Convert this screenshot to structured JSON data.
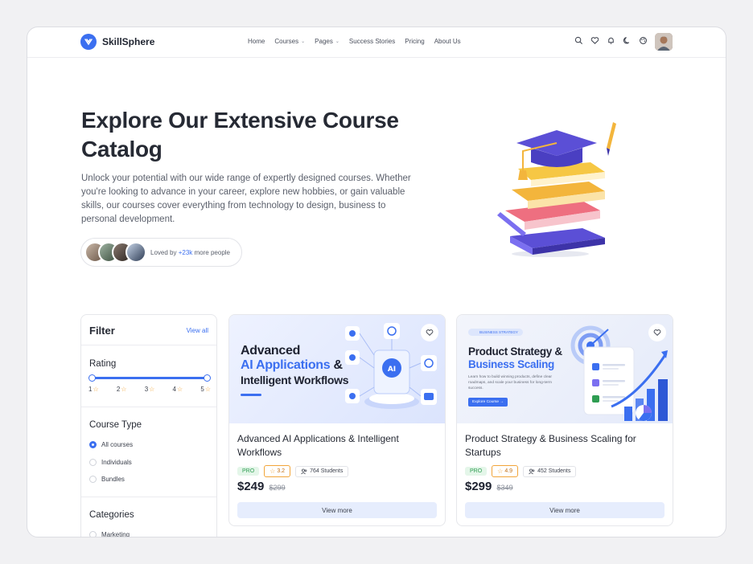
{
  "brand": {
    "name": "SkillSphere"
  },
  "nav": {
    "items": [
      {
        "label": "Home"
      },
      {
        "label": "Courses"
      },
      {
        "label": "Pages"
      },
      {
        "label": "Success Stories"
      },
      {
        "label": "Pricing"
      },
      {
        "label": "About Us"
      }
    ],
    "icons": [
      "search-icon",
      "heart-icon",
      "bell-icon",
      "moon-icon",
      "palette-icon"
    ]
  },
  "hero": {
    "title": "Explore Our Extensive Course Catalog",
    "description": "Unlock your potential with our wide range of expertly designed courses. Whether you're looking to advance in your career, explore new hobbies, or gain valuable skills, our courses cover everything from technology to design, business to personal development.",
    "loved_prefix": "Loved by",
    "loved_count": "+23k",
    "loved_suffix": "more people"
  },
  "filter": {
    "title": "Filter",
    "view_all": "View all",
    "rating_title": "Rating",
    "rating_ticks": [
      "1",
      "2",
      "3",
      "4",
      "5"
    ],
    "type_title": "Course Type",
    "types": [
      {
        "label": "All courses",
        "selected": true
      },
      {
        "label": "Individuals",
        "selected": false
      },
      {
        "label": "Bundles",
        "selected": false
      }
    ],
    "categories_title": "Categories",
    "categories": [
      {
        "label": "Marketing"
      }
    ]
  },
  "courses": [
    {
      "banner_line1": "Advanced",
      "banner_line2": "AI Applications",
      "banner_amp": "&",
      "banner_line3": "Intelligent Workflows",
      "title": "Advanced AI Applications & Intelligent Workflows",
      "badge": "PRO",
      "rating": "3.2",
      "students": "764 Students",
      "price": "$249",
      "old_price": "$299",
      "cta": "View more"
    },
    {
      "banner_tag": "BUSINESS STRATEGY",
      "banner_line1": "Product Strategy &",
      "banner_line2": "Business Scaling",
      "banner_desc": "Learn how to build winning products, define clear roadmaps, and scale your business for long-term success.",
      "banner_button": "Explore Course →",
      "title": "Product Strategy & Business Scaling for Startups",
      "badge": "PRO",
      "rating": "4.9",
      "students": "452 Students",
      "price": "$299",
      "old_price": "$349",
      "cta": "View more"
    }
  ],
  "colors": {
    "accent": "#3b6ff0",
    "pro_bg": "#e4f6e9",
    "rating_border": "#f2a53a"
  }
}
